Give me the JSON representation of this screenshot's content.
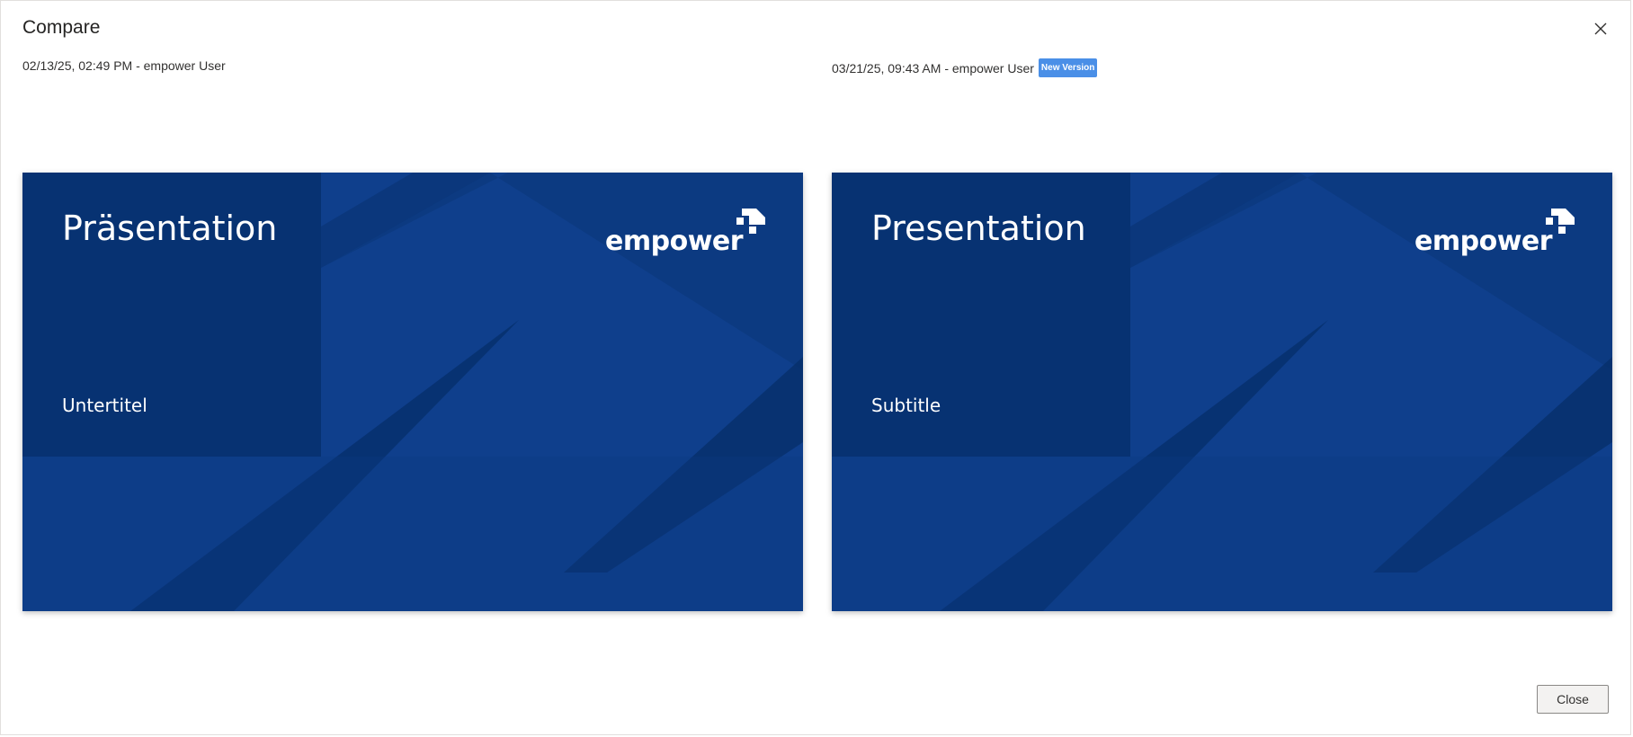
{
  "dialog": {
    "title": "Compare",
    "close_icon": "close-icon",
    "close_button_label": "Close"
  },
  "left": {
    "version_label": "02/13/25, 02:49 PM - empower User",
    "slide": {
      "title": "Präsentation",
      "subtitle": "Untertitel",
      "logo_text": "empower"
    }
  },
  "right": {
    "version_label": "03/21/25, 09:43 AM - empower User",
    "badge": "New Version",
    "slide": {
      "title": "Presentation",
      "subtitle": "Subtitle",
      "logo_text": "empower"
    }
  },
  "colors": {
    "slide_background": "#0f3f8c",
    "slide_dark": "#062f6a",
    "badge": "#4a8fe7"
  }
}
